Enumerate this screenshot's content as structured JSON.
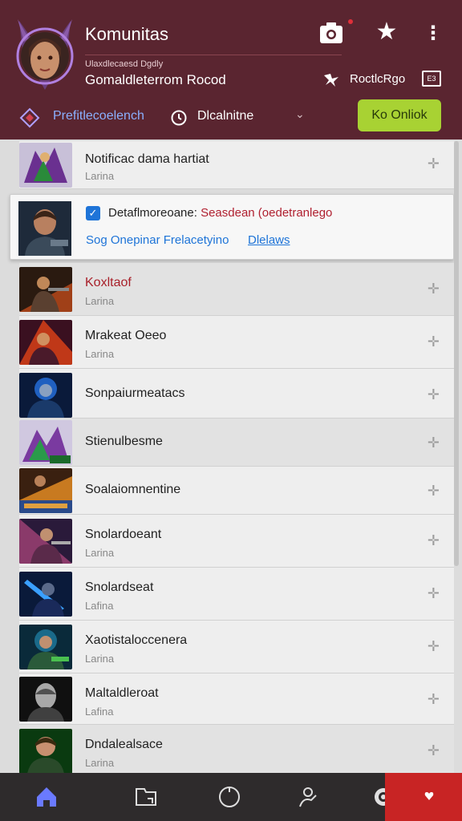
{
  "header": {
    "title": "Komunitas",
    "subtitle": "Ulaxdlecaesd Dgdly",
    "user_line": "Gomaldleterrom Rocod",
    "rank_label": "RoctlcRgo",
    "rank_box": "E3"
  },
  "filter_bar": {
    "filter_label": "Prefitlecoelench",
    "sort_label": "Dlcalnitne",
    "online_button": "Ko Onliok"
  },
  "first_item": {
    "name": "Notificac dama hartiat",
    "sub": "Larina"
  },
  "notification": {
    "text_prefix": "Detaflmoreoane:",
    "text_highlight": "Seasdean (oedetranlego",
    "link_primary": "Sog Onepinar Frelacetyino",
    "link_secondary": "Dlelaws"
  },
  "rows": [
    {
      "name": "Koxltaof",
      "sub": "Larina",
      "red": true
    },
    {
      "name": "Mrakeat Oeeo",
      "sub": "Larina",
      "red": false
    },
    {
      "name": "Sonpaiurmeatacs",
      "sub": "",
      "red": false
    },
    {
      "name": "Stienulbesme",
      "sub": "",
      "red": false
    },
    {
      "name": "Soalaiomnentine",
      "sub": "",
      "red": false
    },
    {
      "name": "Snolardoeant",
      "sub": "Larina",
      "red": false
    },
    {
      "name": "Snolardseat",
      "sub": "Lafina",
      "red": false
    },
    {
      "name": "Xaotistaloccenera",
      "sub": "Larina",
      "red": false
    },
    {
      "name": "Maltaldleroat",
      "sub": "Lafina",
      "red": false
    },
    {
      "name": "Dndalealsace",
      "sub": "Larina",
      "red": false
    }
  ],
  "colors": {
    "header_bg": "#5a2530",
    "accent_green": "#a8d233",
    "link_blue": "#1e74d8",
    "alert_red": "#c82424"
  },
  "icons": {
    "nav": [
      "home-icon",
      "folder-icon",
      "circle-icon",
      "profile-icon",
      "game-icon",
      "heart-icon"
    ]
  }
}
